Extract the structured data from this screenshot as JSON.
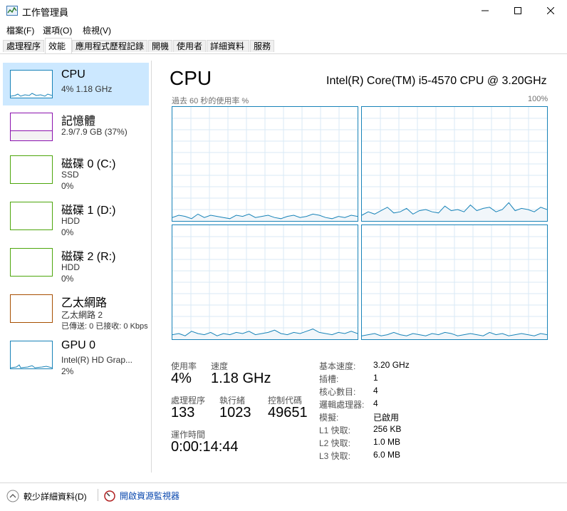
{
  "window": {
    "title": "工作管理員",
    "minimize_icon": "minimize-icon",
    "maximize_icon": "maximize-icon",
    "close_icon": "close-icon"
  },
  "menu": [
    "檔案(F)",
    "選項(O)",
    "檢視(V)"
  ],
  "tabs": [
    {
      "label": "處理程序",
      "active": false
    },
    {
      "label": "效能",
      "active": true
    },
    {
      "label": "應用程式歷程記錄",
      "active": false
    },
    {
      "label": "開機",
      "active": false
    },
    {
      "label": "使用者",
      "active": false
    },
    {
      "label": "詳細資料",
      "active": false
    },
    {
      "label": "服務",
      "active": false
    }
  ],
  "sidebar": [
    {
      "title": "CPU",
      "line2": "4% 1.18 GHz",
      "line3": "",
      "color": "#1883b8",
      "selected": true
    },
    {
      "title": "記憶體",
      "line2": "2.9/7.9 GB (37%)",
      "line3": "",
      "color": "#8b12ae",
      "selected": false
    },
    {
      "title": "磁碟 0 (C:)",
      "line2": "SSD",
      "line3": "0%",
      "color": "#4da60c",
      "selected": false
    },
    {
      "title": "磁碟 1 (D:)",
      "line2": "HDD",
      "line3": "0%",
      "color": "#4da60c",
      "selected": false
    },
    {
      "title": "磁碟 2 (R:)",
      "line2": "HDD",
      "line3": "0%",
      "color": "#4da60c",
      "selected": false
    },
    {
      "title": "乙太網路",
      "line2": "乙太網路 2",
      "line3": "已傳送: 0 已接收: 0 Kbps",
      "color": "#a74f01",
      "selected": false
    },
    {
      "title": "GPU 0",
      "line2": "Intel(R) HD Grap...",
      "line3": "2%",
      "color": "#1883b8",
      "selected": false
    }
  ],
  "main": {
    "heading": "CPU",
    "model": "Intel(R) Core(TM) i5-4570 CPU @ 3.20GHz",
    "graph_label": "過去 60 秒的使用率 %",
    "graph_max": "100%",
    "cores": [
      [
        3,
        5,
        4,
        2,
        6,
        3,
        5,
        4,
        3,
        2,
        5,
        4,
        6,
        3,
        4,
        5,
        3,
        2,
        4,
        5,
        3,
        4,
        6,
        5,
        3,
        2,
        4,
        3,
        5,
        4
      ],
      [
        5,
        8,
        6,
        9,
        12,
        7,
        8,
        11,
        6,
        9,
        10,
        8,
        7,
        13,
        9,
        10,
        8,
        14,
        9,
        11,
        12,
        8,
        10,
        16,
        9,
        11,
        10,
        8,
        12,
        10
      ],
      [
        4,
        5,
        3,
        7,
        5,
        4,
        6,
        3,
        5,
        4,
        6,
        5,
        7,
        4,
        5,
        6,
        8,
        5,
        4,
        6,
        5,
        7,
        9,
        6,
        5,
        4,
        6,
        5,
        7,
        5
      ],
      [
        3,
        4,
        5,
        3,
        4,
        6,
        4,
        3,
        5,
        4,
        3,
        5,
        4,
        6,
        5,
        3,
        4,
        5,
        4,
        3,
        6,
        4,
        5,
        3,
        4,
        5,
        4,
        3,
        5,
        4
      ]
    ],
    "stats": [
      {
        "label": "使用率",
        "value": "4%"
      },
      {
        "label": "速度",
        "value": "1.18 GHz"
      },
      {
        "label": "處理程序",
        "value": "133"
      },
      {
        "label": "執行緒",
        "value": "1023"
      },
      {
        "label": "控制代碼",
        "value": "49651"
      },
      {
        "label": "運作時間",
        "value": "0:00:14:44"
      }
    ],
    "specs": [
      {
        "label": "基本速度:",
        "value": "3.20 GHz"
      },
      {
        "label": "插槽:",
        "value": "1"
      },
      {
        "label": "核心數目:",
        "value": "4"
      },
      {
        "label": "邏輯處理器:",
        "value": "4"
      },
      {
        "label": "模擬:",
        "value": "已啟用"
      },
      {
        "label": "L1 快取:",
        "value": "256 KB"
      },
      {
        "label": "L2 快取:",
        "value": "1.0 MB"
      },
      {
        "label": "L3 快取:",
        "value": "6.0 MB"
      }
    ]
  },
  "footer": {
    "fewer_details": "較少詳細資料(D)",
    "open_resmon": "開啟資源監視器"
  },
  "colors": {
    "accent": "#1883b8",
    "selected_bg": "#cce8ff"
  }
}
